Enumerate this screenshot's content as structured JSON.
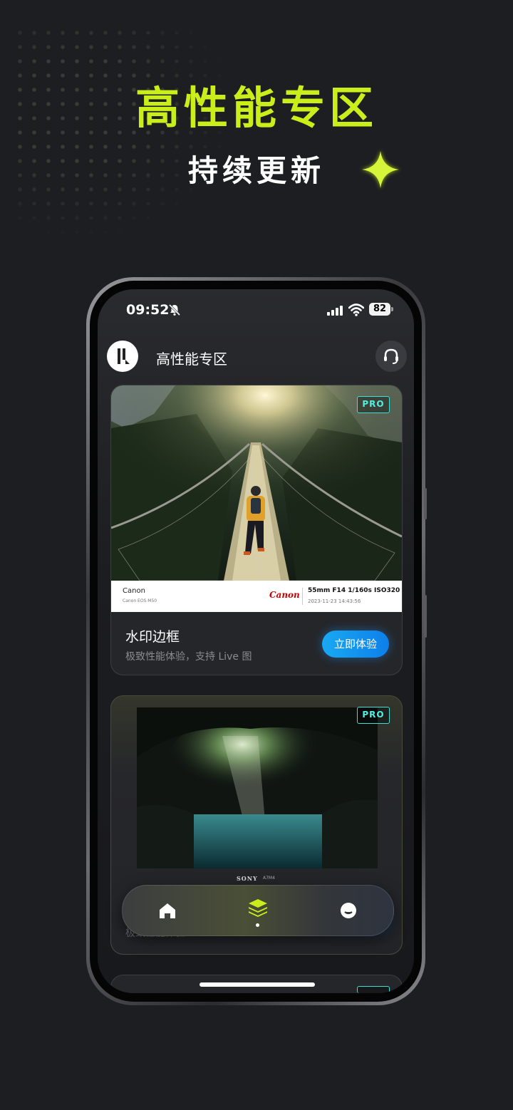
{
  "promo": {
    "title": "高性能专区",
    "subtitle": "持续更新"
  },
  "status_bar": {
    "time": "09:52",
    "battery": "82"
  },
  "header": {
    "title": "高性能专区"
  },
  "cards": [
    {
      "badge": "PRO",
      "title": "水印边框",
      "description": "极致性能体验，支持 Live 图",
      "button": "立即体验",
      "watermark": {
        "brand": "Canon",
        "model": "Canon EOS M50",
        "logo": "Canon",
        "params": "55mm  F14  1/160s  ISO320",
        "date": "2023-11-23 14:43:56"
      }
    },
    {
      "badge": "PRO",
      "description": "极致性能体验",
      "brand": "SONY",
      "model": "A7M4"
    }
  ],
  "tabbar": {
    "items": [
      {
        "icon": "home-icon"
      },
      {
        "icon": "layers-icon"
      },
      {
        "icon": "profile-icon"
      }
    ]
  },
  "colors": {
    "accent": "#c8ef1a",
    "pro_badge": "#38e0d6",
    "cta": "#0d8ef0"
  }
}
